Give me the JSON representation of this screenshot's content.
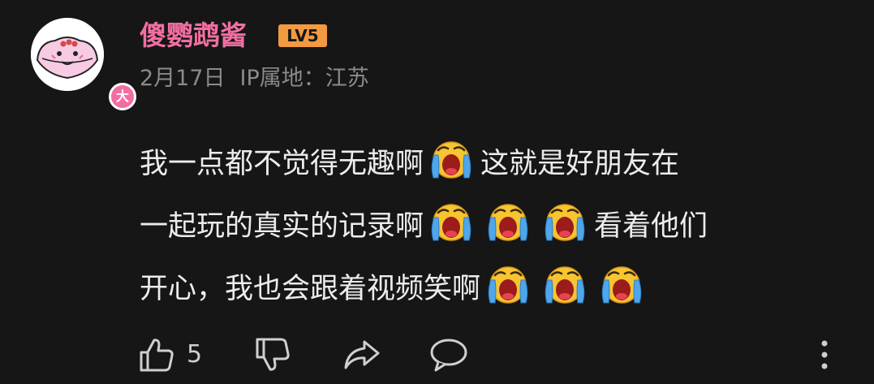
{
  "comment": {
    "username": "傻鹦鹉酱",
    "level_badge": "LV5",
    "avatar_badge": "大",
    "date": "2月17日",
    "ip_location": "IP属地：江苏",
    "content_segments": [
      [
        "我一点都不觉得无趣啊",
        "emoji",
        "这就是好朋友在"
      ],
      [
        "一起玩的真实的记录啊",
        "emoji",
        "emoji",
        "emoji",
        "看着他们"
      ],
      [
        "开心，我也会跟着视频笑啊",
        "emoji",
        "emoji",
        "emoji"
      ]
    ],
    "line1_text_a": "我一点都不觉得无趣啊",
    "line1_text_b": "这就是好朋友在",
    "line2_text_a": "一起玩的真实的记录啊",
    "line2_text_b": "看着他们",
    "line3_text_a": "开心，我也会跟着视频笑啊",
    "emoji_name": "crying-loudly-emoji"
  },
  "actions": {
    "like_count": "5",
    "like_icon": "thumbs-up-icon",
    "dislike_icon": "thumbs-down-icon",
    "share_icon": "share-arrow-icon",
    "reply_icon": "comment-bubble-icon",
    "more_icon": "vertical-ellipsis-icon"
  },
  "colors": {
    "background": "#161616",
    "username": "#f26ea2",
    "level_badge": "#f29a42",
    "meta_text": "#8a8a8a",
    "body_text": "#ececec"
  }
}
